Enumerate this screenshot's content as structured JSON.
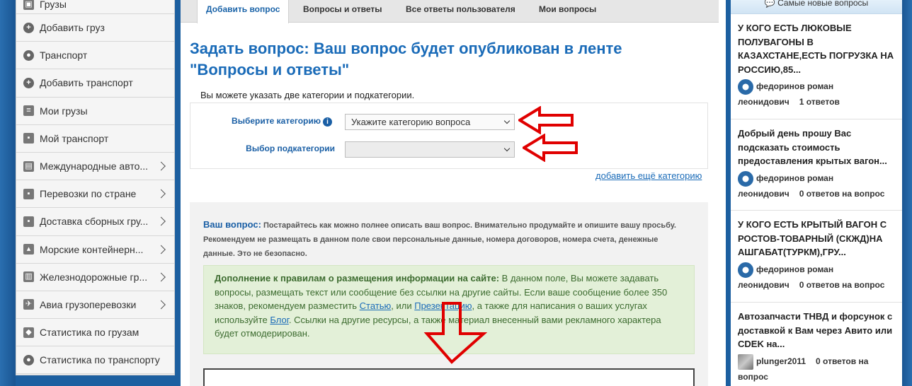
{
  "sidebar": {
    "items": [
      {
        "label": "Грузы",
        "icon": "cargo-icon",
        "chevron": false
      },
      {
        "label": "Добавить груз",
        "icon": "plus-circle-icon",
        "chevron": false
      },
      {
        "label": "Транспорт",
        "icon": "truck-circle-icon",
        "chevron": false
      },
      {
        "label": "Добавить транспорт",
        "icon": "plus-circle-icon",
        "chevron": false
      },
      {
        "label": "Мои грузы",
        "icon": "document-icon",
        "chevron": false
      },
      {
        "label": "Мой транспорт",
        "icon": "truck-icon",
        "chevron": false
      },
      {
        "label": "Международные авто...",
        "icon": "bus-icon",
        "chevron": true
      },
      {
        "label": "Перевозки по стране",
        "icon": "truck-icon",
        "chevron": true
      },
      {
        "label": "Доставка сборных гру...",
        "icon": "truck-icon",
        "chevron": true
      },
      {
        "label": "Морские контейнерн...",
        "icon": "ship-icon",
        "chevron": true
      },
      {
        "label": "Железнодорожные гр...",
        "icon": "train-icon",
        "chevron": true
      },
      {
        "label": "Авиа грузоперевозки",
        "icon": "plane-icon",
        "chevron": true
      },
      {
        "label": "Статистика по грузам",
        "icon": "box-icon",
        "chevron": false
      },
      {
        "label": "Статистика по транспорту",
        "icon": "truck-circle-icon",
        "chevron": false
      }
    ]
  },
  "tabs": [
    {
      "label": "Добавить вопрос",
      "active": true
    },
    {
      "label": "Вопросы и ответы",
      "active": false
    },
    {
      "label": "Все ответы пользователя",
      "active": false
    },
    {
      "label": "Мои вопросы",
      "active": false
    }
  ],
  "page": {
    "title": "Задать вопрос: Ваш вопрос будет опубликован в ленте \"Вопросы и ответы\"",
    "hint": "Вы можете указать две категории и подкатегории.",
    "category_label": "Выберите категорию",
    "category_placeholder": "Укажите категорию вопроса",
    "subcategory_label": "Выбор подкатегории",
    "subcategory_value": "",
    "add_category": "добавить ещё категорию",
    "question_label": "Ваш вопрос:",
    "question_hint": "Постарайтесь как можно полнее описать ваш вопрос. Внимательно продумайте и опишите вашу просьбу. Рекомендуем не размещать в данном поле свои персональные данные, номера договоров, номера счета, денежные данные. Это не безопасно.",
    "rules": {
      "heading": "Дополнение к правилам о размещения информации на сайте:",
      "text1": " В данном поле, Вы можете задавать вопросы, размещать текст или сообщение без ссылки на другие сайты. Если ваше сообщение более 350 знаков, рекомендуем разместить ",
      "link_article": "Статью",
      "text2": ", или ",
      "link_presentation": "Презентацию",
      "text3": ", а также для написания о ваших услугах используйте ",
      "link_blog": "Блог",
      "text4": ". Ссылки на другие ресурсы, а также материал внесенный вами рекламного характера будет отмодерирован."
    }
  },
  "right": {
    "header": "Самые новые вопросы",
    "posts": [
      {
        "title": "У КОГО ЕСТЬ ЛЮКОВЫЕ ПОЛУВАГОНЫ В КАЗАХСТАНЕ,ЕСТЬ ПОГРУЗКА НА РОССИЮ,85...",
        "author": "федоринов роман леонидович",
        "answers": "1 ответов",
        "avatar": "logo"
      },
      {
        "title": "Добрый день прошу Вас подсказать стоимость предоставления крытых вагон...",
        "author": "федоринов роман леонидович",
        "answers": "0 ответов на вопрос",
        "avatar": "logo"
      },
      {
        "title": "У КОГО ЕСТЬ КРЫТЫЙ ВАГОН С РОСТОВ-ТОВАРНЫЙ (СКЖД)НА АШГАБАТ(ТУРКМ),ГРУ...",
        "author": "федоринов роман леонидович",
        "answers": "0 ответов на вопрос",
        "avatar": "logo"
      },
      {
        "title": "Автозапчасти ТНВД и форсунок с доставкой к Вам через Авито или CDEK на...",
        "author": "plunger2011",
        "answers": "0 ответов на вопрос",
        "avatar": "photo"
      }
    ]
  },
  "colors": {
    "accent": "#1a6bb8",
    "arrow": "#e00000",
    "rules_bg": "#e3f0d8"
  }
}
